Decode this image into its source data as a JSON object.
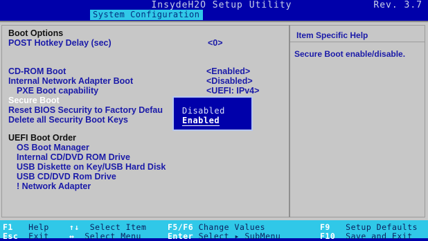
{
  "header": {
    "title": "InsydeH2O Setup Utility",
    "revision": "Rev. 3.7",
    "active_tab": "System Configuration"
  },
  "left_panel": {
    "items": [
      {
        "label": "Boot Options",
        "value": ""
      },
      {
        "label": "POST Hotkey Delay (sec)",
        "value": "<0>"
      },
      {
        "label": "CD-ROM Boot",
        "value": "<Enabled>"
      },
      {
        "label": "Internal Network Adapter Boot",
        "value": "<Disabled>"
      },
      {
        "label": "PXE Boot capability",
        "value": "<UEFI: IPv4>"
      },
      {
        "label": "Secure Boot",
        "value": ""
      },
      {
        "label": "Reset BIOS Security to Factory Defau",
        "value": ""
      },
      {
        "label": "Delete all Security Boot Keys",
        "value": ""
      },
      {
        "label": "UEFI Boot Order",
        "value": ""
      },
      {
        "label": "OS Boot Manager",
        "value": ""
      },
      {
        "label": "Internal CD/DVD ROM Drive",
        "value": ""
      },
      {
        "label": "USB Diskette on Key/USB Hard Disk",
        "value": ""
      },
      {
        "label": "USB CD/DVD Rom Drive",
        "value": ""
      },
      {
        "label": "! Network Adapter",
        "value": ""
      }
    ]
  },
  "help_panel": {
    "title": "Item Specific Help",
    "text": "Secure Boot enable/disable."
  },
  "popup": {
    "options": [
      "Disabled",
      "Enabled"
    ],
    "selected": "Enabled"
  },
  "footer": {
    "hotkeys": [
      {
        "key": "F1",
        "desc": "Help"
      },
      {
        "key": "↑↓",
        "desc": "Select Item"
      },
      {
        "key": "F5/F6",
        "desc": "Change Values"
      },
      {
        "key": "F9",
        "desc": "Setup Defaults"
      },
      {
        "key": "Esc",
        "desc": "Exit"
      },
      {
        "key": "↔",
        "desc": "Select Menu"
      },
      {
        "key": "Enter",
        "desc": "Select ▸ SubMenu"
      },
      {
        "key": "F10",
        "desc": "Save and Exit"
      }
    ]
  },
  "colors": {
    "background": "#0000aa",
    "panel": "#c7c7c7",
    "accent": "#30c8e8",
    "text_blue": "#1a1aa8"
  }
}
